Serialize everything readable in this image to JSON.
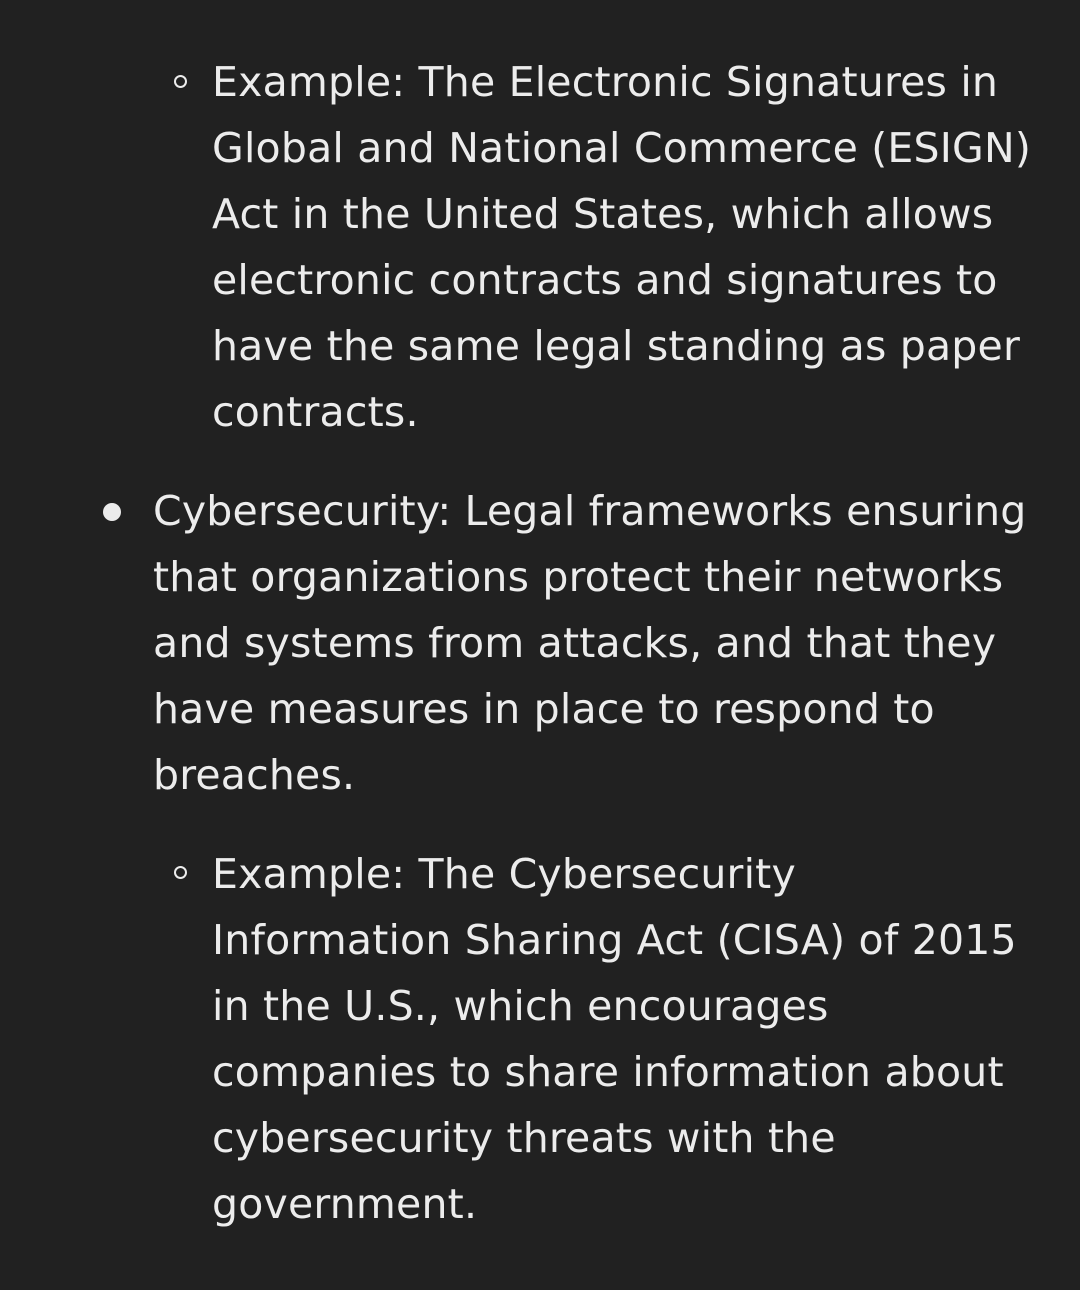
{
  "list": {
    "items": [
      {
        "level": 2,
        "text": "Example: The Electronic Signatures in Global and National Commerce (ESIGN) Act in the United States, which allows electronic contracts and signatures to have the same legal standing as paper contracts."
      },
      {
        "level": 1,
        "text": "Cybersecurity: Legal frameworks ensuring that organizations protect their networks and systems from attacks, and that they have measures in place to respond to breaches."
      },
      {
        "level": 2,
        "text": "Example: The Cybersecurity Information Sharing Act (CISA) of 2015 in the U.S., which encourages companies to share information about cybersecurity threats with the government."
      }
    ]
  }
}
